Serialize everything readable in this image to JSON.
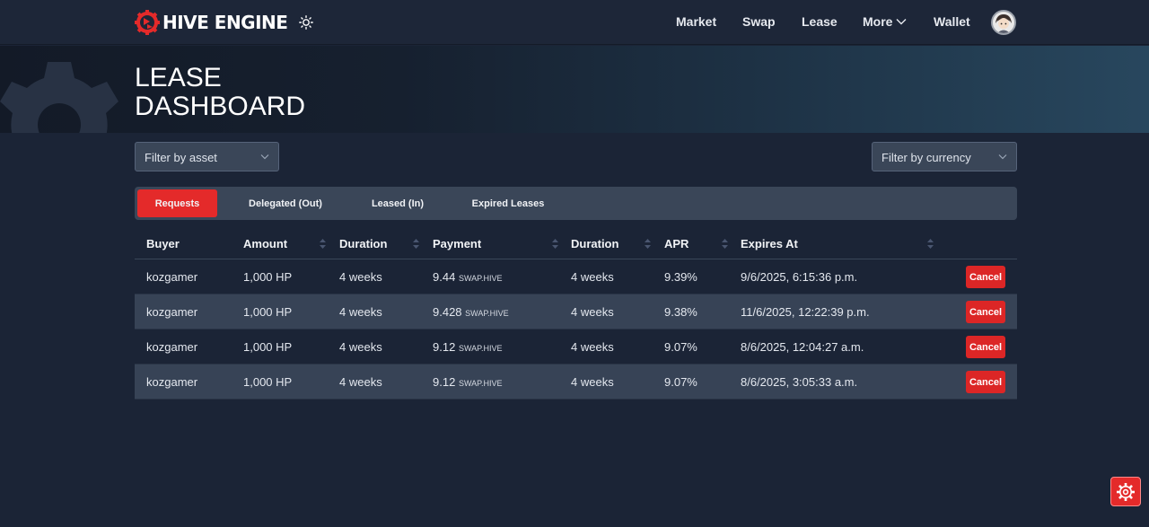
{
  "brand": {
    "logo_text": "HIVE ENGINE",
    "accent": "#e42a2a"
  },
  "nav": {
    "market": "Market",
    "swap": "Swap",
    "lease": "Lease",
    "more": "More",
    "wallet": "Wallet"
  },
  "hero": {
    "title_line1": "LEASE",
    "title_line2": "DASHBOARD"
  },
  "filters": {
    "asset": {
      "value": "Filter by asset"
    },
    "currency": {
      "value": "Filter by currency"
    }
  },
  "tabs": [
    {
      "label": "Requests",
      "active": true
    },
    {
      "label": "Delegated (Out)",
      "active": false
    },
    {
      "label": "Leased (In)",
      "active": false
    },
    {
      "label": "Expired Leases",
      "active": false
    }
  ],
  "table": {
    "headers": {
      "buyer": "Buyer",
      "amount": "Amount",
      "duration": "Duration",
      "payment": "Payment",
      "duration2": "Duration",
      "apr": "APR",
      "expires": "Expires At"
    },
    "rows": [
      {
        "buyer": "kozgamer",
        "amount": "1,000 HP",
        "duration": "4 weeks",
        "payment_value": "9.44",
        "payment_unit": "SWAP.HIVE",
        "duration2": "4 weeks",
        "apr": "9.39%",
        "expires": "9/6/2025, 6:15:36 p.m.",
        "action": "Cancel"
      },
      {
        "buyer": "kozgamer",
        "amount": "1,000 HP",
        "duration": "4 weeks",
        "payment_value": "9.428",
        "payment_unit": "SWAP.HIVE",
        "duration2": "4 weeks",
        "apr": "9.38%",
        "expires": "11/6/2025, 12:22:39 p.m.",
        "action": "Cancel"
      },
      {
        "buyer": "kozgamer",
        "amount": "1,000 HP",
        "duration": "4 weeks",
        "payment_value": "9.12",
        "payment_unit": "SWAP.HIVE",
        "duration2": "4 weeks",
        "apr": "9.07%",
        "expires": "8/6/2025, 12:04:27 a.m.",
        "action": "Cancel"
      },
      {
        "buyer": "kozgamer",
        "amount": "1,000 HP",
        "duration": "4 weeks",
        "payment_value": "9.12",
        "payment_unit": "SWAP.HIVE",
        "duration2": "4 weeks",
        "apr": "9.07%",
        "expires": "8/6/2025, 3:05:33 a.m.",
        "action": "Cancel"
      }
    ]
  },
  "icons": {
    "logo": "hive-engine-gear-icon",
    "theme": "sun-icon",
    "more": "chevron-down-icon",
    "sort": "sort-icon",
    "floating": "gear-icon"
  }
}
